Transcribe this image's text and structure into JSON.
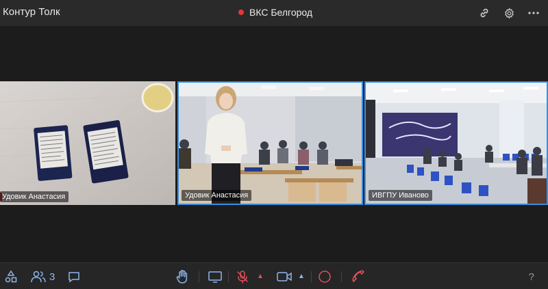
{
  "header": {
    "app_title": "Контур Толк",
    "meeting_title": "ВКС Белгород",
    "icons": [
      "link-icon",
      "gear-icon",
      "more-icon"
    ]
  },
  "tiles": [
    {
      "name": "Удовик Анастасия",
      "scene": "documents-on-desk"
    },
    {
      "name": "Удовик Анастасия",
      "scene": "classroom-presenter"
    },
    {
      "name": "ИВГПУ Иваново",
      "scene": "conference-hall"
    }
  ],
  "footer": {
    "participants_count": "3",
    "help_label": "?",
    "icons": [
      "shapes-icon",
      "participants-icon",
      "chat-icon",
      "raise-hand-icon",
      "screen-share-icon",
      "microphone-muted-icon",
      "camera-icon",
      "record-icon",
      "hangup-icon"
    ]
  },
  "colors": {
    "accent": "#3b8fe0",
    "record": "#e5383b",
    "muted": "#e0505a",
    "icon_blue": "#8fb6f0"
  }
}
